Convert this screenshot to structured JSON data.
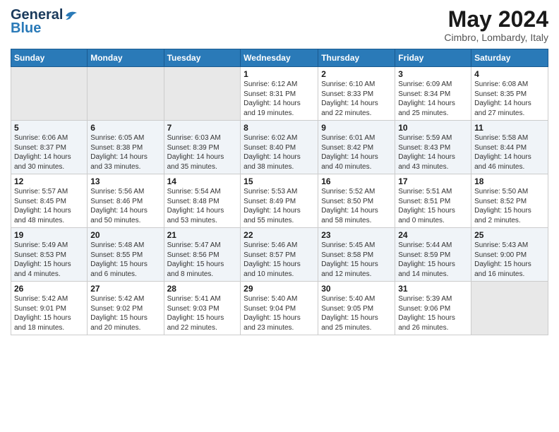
{
  "logo": {
    "line1": "General",
    "line2": "Blue"
  },
  "title": "May 2024",
  "location": "Cimbro, Lombardy, Italy",
  "days_of_week": [
    "Sunday",
    "Monday",
    "Tuesday",
    "Wednesday",
    "Thursday",
    "Friday",
    "Saturday"
  ],
  "weeks": [
    [
      {
        "num": "",
        "info": ""
      },
      {
        "num": "",
        "info": ""
      },
      {
        "num": "",
        "info": ""
      },
      {
        "num": "1",
        "info": "Sunrise: 6:12 AM\nSunset: 8:31 PM\nDaylight: 14 hours\nand 19 minutes."
      },
      {
        "num": "2",
        "info": "Sunrise: 6:10 AM\nSunset: 8:33 PM\nDaylight: 14 hours\nand 22 minutes."
      },
      {
        "num": "3",
        "info": "Sunrise: 6:09 AM\nSunset: 8:34 PM\nDaylight: 14 hours\nand 25 minutes."
      },
      {
        "num": "4",
        "info": "Sunrise: 6:08 AM\nSunset: 8:35 PM\nDaylight: 14 hours\nand 27 minutes."
      }
    ],
    [
      {
        "num": "5",
        "info": "Sunrise: 6:06 AM\nSunset: 8:37 PM\nDaylight: 14 hours\nand 30 minutes."
      },
      {
        "num": "6",
        "info": "Sunrise: 6:05 AM\nSunset: 8:38 PM\nDaylight: 14 hours\nand 33 minutes."
      },
      {
        "num": "7",
        "info": "Sunrise: 6:03 AM\nSunset: 8:39 PM\nDaylight: 14 hours\nand 35 minutes."
      },
      {
        "num": "8",
        "info": "Sunrise: 6:02 AM\nSunset: 8:40 PM\nDaylight: 14 hours\nand 38 minutes."
      },
      {
        "num": "9",
        "info": "Sunrise: 6:01 AM\nSunset: 8:42 PM\nDaylight: 14 hours\nand 40 minutes."
      },
      {
        "num": "10",
        "info": "Sunrise: 5:59 AM\nSunset: 8:43 PM\nDaylight: 14 hours\nand 43 minutes."
      },
      {
        "num": "11",
        "info": "Sunrise: 5:58 AM\nSunset: 8:44 PM\nDaylight: 14 hours\nand 46 minutes."
      }
    ],
    [
      {
        "num": "12",
        "info": "Sunrise: 5:57 AM\nSunset: 8:45 PM\nDaylight: 14 hours\nand 48 minutes."
      },
      {
        "num": "13",
        "info": "Sunrise: 5:56 AM\nSunset: 8:46 PM\nDaylight: 14 hours\nand 50 minutes."
      },
      {
        "num": "14",
        "info": "Sunrise: 5:54 AM\nSunset: 8:48 PM\nDaylight: 14 hours\nand 53 minutes."
      },
      {
        "num": "15",
        "info": "Sunrise: 5:53 AM\nSunset: 8:49 PM\nDaylight: 14 hours\nand 55 minutes."
      },
      {
        "num": "16",
        "info": "Sunrise: 5:52 AM\nSunset: 8:50 PM\nDaylight: 14 hours\nand 58 minutes."
      },
      {
        "num": "17",
        "info": "Sunrise: 5:51 AM\nSunset: 8:51 PM\nDaylight: 15 hours\nand 0 minutes."
      },
      {
        "num": "18",
        "info": "Sunrise: 5:50 AM\nSunset: 8:52 PM\nDaylight: 15 hours\nand 2 minutes."
      }
    ],
    [
      {
        "num": "19",
        "info": "Sunrise: 5:49 AM\nSunset: 8:53 PM\nDaylight: 15 hours\nand 4 minutes."
      },
      {
        "num": "20",
        "info": "Sunrise: 5:48 AM\nSunset: 8:55 PM\nDaylight: 15 hours\nand 6 minutes."
      },
      {
        "num": "21",
        "info": "Sunrise: 5:47 AM\nSunset: 8:56 PM\nDaylight: 15 hours\nand 8 minutes."
      },
      {
        "num": "22",
        "info": "Sunrise: 5:46 AM\nSunset: 8:57 PM\nDaylight: 15 hours\nand 10 minutes."
      },
      {
        "num": "23",
        "info": "Sunrise: 5:45 AM\nSunset: 8:58 PM\nDaylight: 15 hours\nand 12 minutes."
      },
      {
        "num": "24",
        "info": "Sunrise: 5:44 AM\nSunset: 8:59 PM\nDaylight: 15 hours\nand 14 minutes."
      },
      {
        "num": "25",
        "info": "Sunrise: 5:43 AM\nSunset: 9:00 PM\nDaylight: 15 hours\nand 16 minutes."
      }
    ],
    [
      {
        "num": "26",
        "info": "Sunrise: 5:42 AM\nSunset: 9:01 PM\nDaylight: 15 hours\nand 18 minutes."
      },
      {
        "num": "27",
        "info": "Sunrise: 5:42 AM\nSunset: 9:02 PM\nDaylight: 15 hours\nand 20 minutes."
      },
      {
        "num": "28",
        "info": "Sunrise: 5:41 AM\nSunset: 9:03 PM\nDaylight: 15 hours\nand 22 minutes."
      },
      {
        "num": "29",
        "info": "Sunrise: 5:40 AM\nSunset: 9:04 PM\nDaylight: 15 hours\nand 23 minutes."
      },
      {
        "num": "30",
        "info": "Sunrise: 5:40 AM\nSunset: 9:05 PM\nDaylight: 15 hours\nand 25 minutes."
      },
      {
        "num": "31",
        "info": "Sunrise: 5:39 AM\nSunset: 9:06 PM\nDaylight: 15 hours\nand 26 minutes."
      },
      {
        "num": "",
        "info": ""
      }
    ]
  ]
}
